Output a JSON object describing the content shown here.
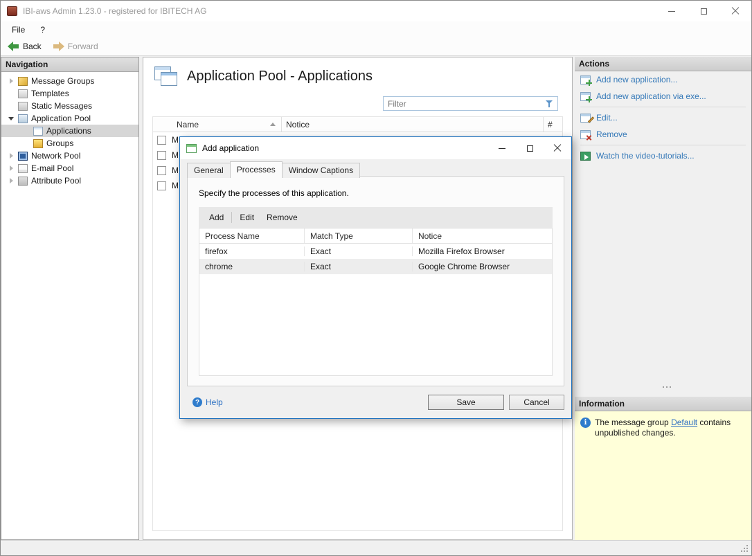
{
  "window": {
    "title": "IBI-aws Admin 1.23.0 - registered for IBITECH AG"
  },
  "menu": {
    "file": "File",
    "help": "?"
  },
  "toolbar": {
    "back": "Back",
    "forward": "Forward"
  },
  "navigation": {
    "header": "Navigation",
    "items": [
      {
        "label": "Message Groups",
        "state": "collapsed"
      },
      {
        "label": "Templates",
        "state": "leaf"
      },
      {
        "label": "Static Messages",
        "state": "leaf"
      },
      {
        "label": "Application Pool",
        "state": "expanded"
      },
      {
        "label": "Applications",
        "state": "leaf",
        "selected": true
      },
      {
        "label": "Groups",
        "state": "leaf"
      },
      {
        "label": "Network Pool",
        "state": "collapsed"
      },
      {
        "label": "E-mail Pool",
        "state": "collapsed"
      },
      {
        "label": "Attribute Pool",
        "state": "collapsed"
      }
    ]
  },
  "main": {
    "title": "Application Pool - Applications",
    "filter_placeholder": "Filter",
    "columns": {
      "name": "Name",
      "notice": "Notice",
      "count": "#"
    },
    "rows": [
      {
        "name": "M"
      },
      {
        "name": "M"
      },
      {
        "name": "M"
      },
      {
        "name": "M"
      }
    ]
  },
  "dialog": {
    "title": "Add application",
    "tabs": {
      "general": "General",
      "processes": "Processes",
      "window_captions": "Window Captions"
    },
    "description": "Specify the processes of this application.",
    "toolbar": {
      "add": "Add",
      "edit": "Edit",
      "remove": "Remove"
    },
    "columns": {
      "process_name": "Process Name",
      "match_type": "Match Type",
      "notice": "Notice"
    },
    "rows": [
      {
        "process_name": "firefox",
        "match_type": "Exact",
        "notice": "Mozilla Firefox Browser",
        "selected": false
      },
      {
        "process_name": "chrome",
        "match_type": "Exact",
        "notice": "Google Chrome Browser",
        "selected": true
      }
    ],
    "help": "Help",
    "save": "Save",
    "cancel": "Cancel"
  },
  "actions": {
    "header": "Actions",
    "items": [
      {
        "label": "Add new application..."
      },
      {
        "label": "Add new application via exe..."
      },
      {
        "label": "Edit..."
      },
      {
        "label": "Remove"
      },
      {
        "label": "Watch the video-tutorials..."
      }
    ]
  },
  "information": {
    "header": "Information",
    "text_before": "The message group ",
    "link": "Default",
    "text_after": " contains unpublished changes."
  },
  "colors": {
    "accent_blue": "#1b6fbd",
    "link_blue": "#3579b8",
    "info_bg": "#ffffd9",
    "selection_gray": "#d6d6d6"
  }
}
